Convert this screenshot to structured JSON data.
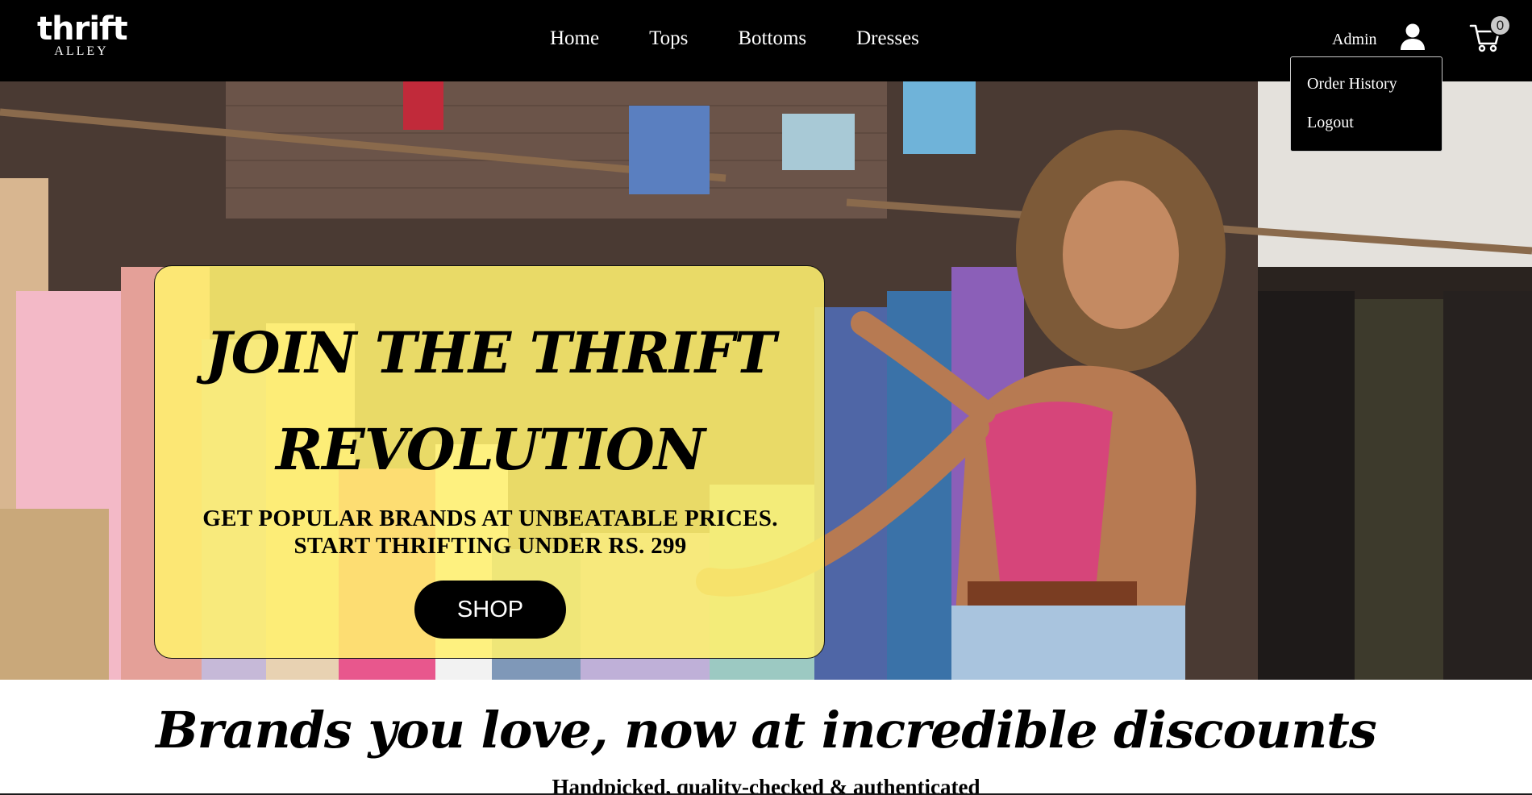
{
  "header": {
    "logo": {
      "main": "thrift",
      "sub": "ALLEY"
    },
    "nav": [
      {
        "label": "Home"
      },
      {
        "label": "Tops"
      },
      {
        "label": "Bottoms"
      },
      {
        "label": "Dresses"
      }
    ],
    "admin_label": "Admin",
    "user_icon": "user-icon",
    "cart_icon": "cart-icon",
    "cart_count": "0"
  },
  "user_menu": {
    "items": [
      {
        "label": "Order History"
      },
      {
        "label": "Logout"
      }
    ]
  },
  "hero": {
    "heading_line1": "JOIN THE THRIFT",
    "heading_line2": "REVOLUTION",
    "subtitle_line1": "GET POPULAR BRANDS AT UNBEATABLE PRICES.",
    "subtitle_line2": "START THRIFTING UNDER RS. 299",
    "cta_label": "SHOP"
  },
  "brands_section": {
    "title": "Brands you love, now at incredible discounts",
    "subtitle": "Handpicked, quality-checked & authenticated"
  },
  "colors": {
    "header_bg": "#000000",
    "promo_card": "#fff06e",
    "button_bg": "#000000",
    "text_light": "#ffffff"
  }
}
